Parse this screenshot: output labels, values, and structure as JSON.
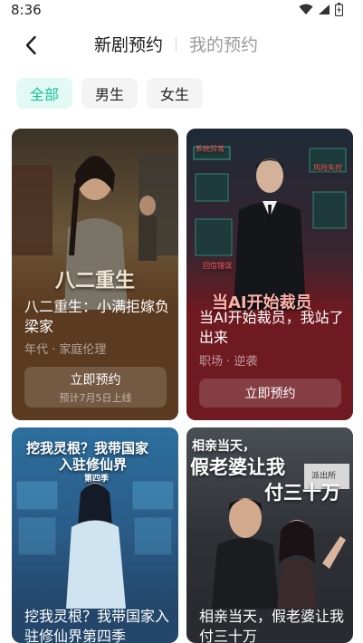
{
  "status_bar": {
    "time": "8:36"
  },
  "header": {
    "tabs": [
      {
        "label": "新剧预约",
        "active": true
      },
      {
        "label": "我的预约",
        "active": false
      }
    ]
  },
  "filters": [
    {
      "label": "全部",
      "selected": true
    },
    {
      "label": "男生",
      "selected": false
    },
    {
      "label": "女生",
      "selected": false
    }
  ],
  "cards": [
    {
      "poster_text": "八二重生",
      "title": "八二重生：小满拒嫁负梁家",
      "meta": "年代 · 家庭伦理",
      "button_label": "立即预约",
      "button_sub": "预计7月5日上线"
    },
    {
      "poster_text": "当AI开始裁员",
      "poster_tags": [
        "系统异常",
        "风险失控",
        "回信错误"
      ],
      "title": "当AI开始裁员，我站了出来",
      "meta": "职场 · 逆袭",
      "button_label": "立即预约"
    },
    {
      "poster_text_lines": [
        "挖我灵根？我带国家",
        "入驻修仙界"
      ],
      "poster_season": "第四季",
      "title": "挖我灵根？我带国家入驻修仙界第四季"
    },
    {
      "poster_text_lines": [
        "相亲当天，",
        "假老婆让我",
        "付三十万"
      ],
      "poster_sign": "派出所",
      "title": "相亲当天，假老婆让我付三十万"
    }
  ],
  "colors": {
    "accent": "#17c39a",
    "chip_selected_bg": "#e3faf4",
    "card1_bg": "#5a3a20",
    "card2_bg": "#6e1a20"
  }
}
